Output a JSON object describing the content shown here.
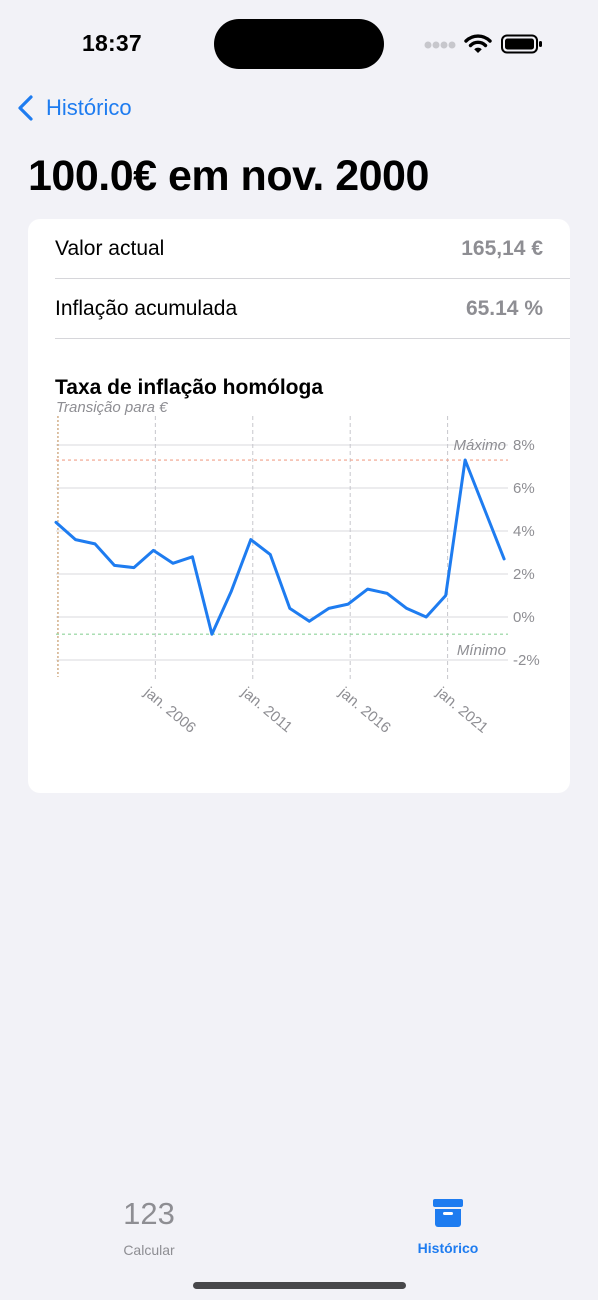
{
  "status_bar": {
    "time": "18:37"
  },
  "nav": {
    "back_label": "Histórico"
  },
  "page_title": "100.0€ em nov. 2000",
  "summary": {
    "rows": [
      {
        "label": "Valor actual",
        "value": "165,14 €"
      },
      {
        "label": "Inflação acumulada",
        "value": "65.14 %"
      }
    ]
  },
  "chart_data": {
    "type": "line",
    "title": "Taxa de inflação homóloga",
    "y_ticks": [
      "8%",
      "6%",
      "4%",
      "2%",
      "0%",
      "-2%"
    ],
    "ylim": [
      -2,
      8
    ],
    "x_ticks": [
      {
        "label": "jan. 2006",
        "x": 2006.0
      },
      {
        "label": "jan. 2011",
        "x": 2011.0
      },
      {
        "label": "jan. 2016",
        "x": 2016.0
      },
      {
        "label": "jan. 2021",
        "x": 2021.0
      }
    ],
    "xlim": [
      2000.9,
      2024.1
    ],
    "grid": true,
    "series": [
      {
        "color": "#1e7cf0",
        "points": [
          [
            2000.9,
            4.4
          ],
          [
            2001.9,
            3.6
          ],
          [
            2002.9,
            3.4
          ],
          [
            2003.9,
            2.4
          ],
          [
            2004.9,
            2.3
          ],
          [
            2005.9,
            3.1
          ],
          [
            2006.9,
            2.5
          ],
          [
            2007.9,
            2.8
          ],
          [
            2008.9,
            -0.8
          ],
          [
            2009.9,
            1.2
          ],
          [
            2010.9,
            3.6
          ],
          [
            2011.9,
            2.9
          ],
          [
            2012.9,
            0.4
          ],
          [
            2013.9,
            -0.2
          ],
          [
            2014.9,
            0.4
          ],
          [
            2015.9,
            0.6
          ],
          [
            2016.9,
            1.3
          ],
          [
            2017.9,
            1.1
          ],
          [
            2018.9,
            0.4
          ],
          [
            2019.9,
            0.0
          ],
          [
            2020.9,
            1.0
          ],
          [
            2021.9,
            7.3
          ],
          [
            2022.9,
            5.0
          ],
          [
            2023.9,
            2.7
          ]
        ]
      }
    ],
    "annotations": {
      "euro_transition": {
        "label": "Transição para €",
        "x": 2001.0,
        "color": "#c79a6b"
      },
      "max": {
        "label": "Máximo",
        "y": 7.3,
        "color": "#f0a08a"
      },
      "min": {
        "label": "Mínimo",
        "y": -0.8,
        "color": "#8fd49a"
      }
    }
  },
  "tabbar": {
    "tabs": [
      {
        "icon_text": "123",
        "label": "Calcular"
      },
      {
        "icon": "archive-box-icon",
        "label": "Histórico"
      }
    ]
  },
  "colors": {
    "accent": "#1e7cf0",
    "background": "#f2f2f7",
    "card": "#ffffff",
    "secondary_text": "#8e8e93"
  }
}
